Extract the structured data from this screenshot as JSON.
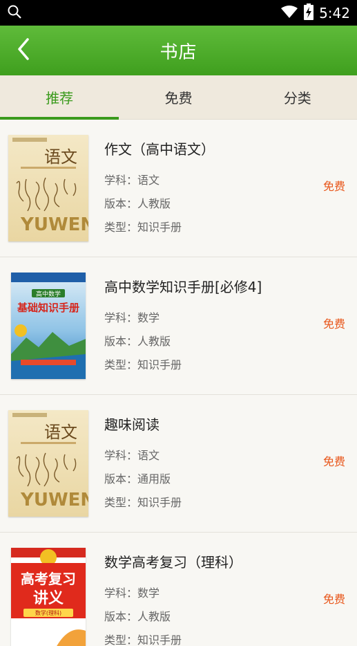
{
  "status": {
    "time": "5:42"
  },
  "header": {
    "title": "书店"
  },
  "tabs": [
    {
      "label": "推荐",
      "active": true
    },
    {
      "label": "免费",
      "active": false
    },
    {
      "label": "分类",
      "active": false
    }
  ],
  "books": [
    {
      "title": "作文（高中语文）",
      "subject": "学科：语文",
      "edition": "版本：人教版",
      "type": "类型：知识手册",
      "price": "免费",
      "cover": {
        "style": "yuwen",
        "top_text": "语文",
        "bottom_text": "YUWEN"
      }
    },
    {
      "title": "高中数学知识手册[必修4]",
      "subject": "学科：数学",
      "edition": "版本：人教版",
      "type": "类型：知识手册",
      "price": "免费",
      "cover": {
        "style": "math",
        "line1": "高中数学",
        "line2": "基础知识手册"
      }
    },
    {
      "title": "趣味阅读",
      "subject": "学科：语文",
      "edition": "版本：通用版",
      "type": "类型：知识手册",
      "price": "免费",
      "cover": {
        "style": "yuwen",
        "top_text": "语文",
        "bottom_text": "YUWEN"
      }
    },
    {
      "title": "数学高考复习（理科）",
      "subject": "学科：数学",
      "edition": "版本：人教版",
      "type": "类型：知识手册",
      "price": "免费",
      "cover": {
        "style": "review",
        "line1": "高考复习",
        "line2": "讲义",
        "line3": "数学(理科)"
      }
    }
  ],
  "colors": {
    "accent": "#3a9a1c",
    "price": "#e8561a",
    "header": "#4aaa2a"
  }
}
